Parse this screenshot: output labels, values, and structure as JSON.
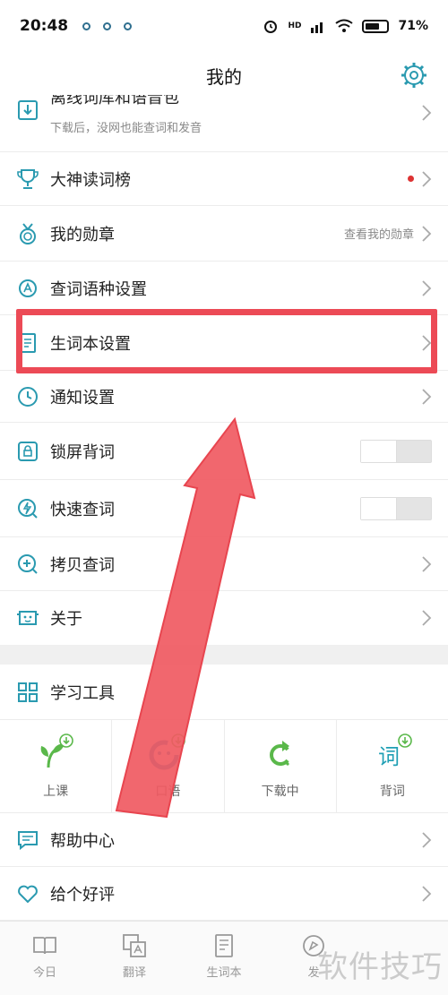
{
  "status": {
    "time": "20:48",
    "battery": "71%",
    "battery_level": 0.71,
    "net": "HD"
  },
  "nav": {
    "title": "我的"
  },
  "rows": [
    {
      "label": "离线词库和语音包",
      "sub": "下载后，没网也能查词和发音"
    },
    {
      "label": "大神读词榜"
    },
    {
      "label": "我的勋章",
      "right_text": "查看我的勋章"
    },
    {
      "label": "查词语种设置"
    },
    {
      "label": "生词本设置"
    },
    {
      "label": "通知设置"
    },
    {
      "label": "锁屏背词"
    },
    {
      "label": "快速查词"
    },
    {
      "label": "拷贝查词"
    },
    {
      "label": "关于"
    }
  ],
  "tools": {
    "title": "学习工具",
    "items": [
      {
        "label": "上课"
      },
      {
        "label": "口语"
      },
      {
        "label": "下载中"
      },
      {
        "label": "背词"
      }
    ]
  },
  "more_rows": [
    {
      "label": "帮助中心"
    },
    {
      "label": "给个好评"
    }
  ],
  "tabs": [
    {
      "label": "今日"
    },
    {
      "label": "翻译"
    },
    {
      "label": "生词本"
    },
    {
      "label": "发"
    }
  ],
  "watermark": "软件技巧",
  "colors": {
    "accent": "#2a9ab0",
    "highlight": "#ec4a56",
    "green": "#5ab84a"
  }
}
